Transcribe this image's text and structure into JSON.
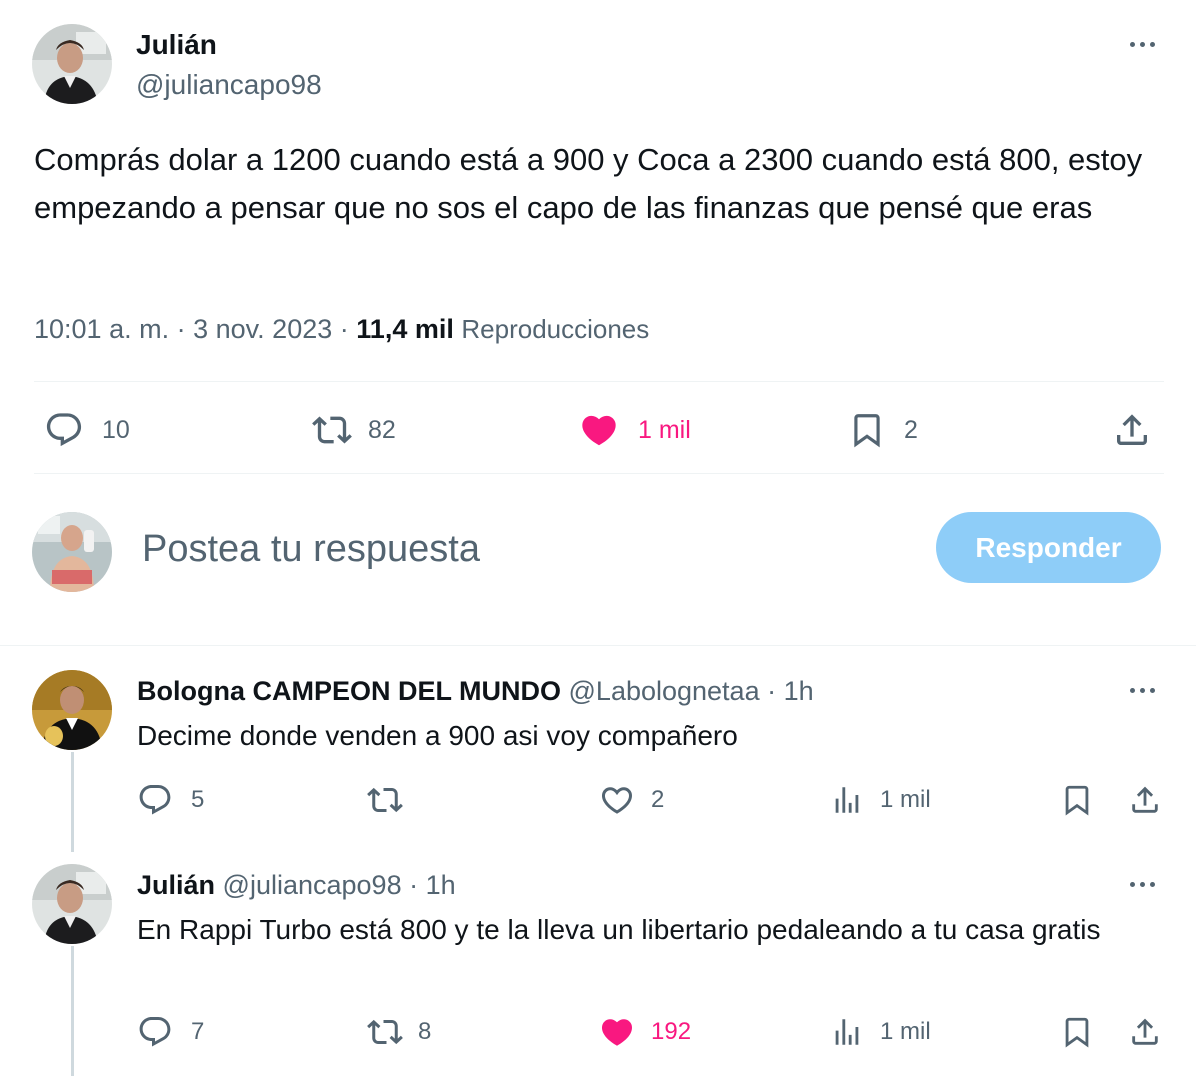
{
  "main_tweet": {
    "author_name": "Julián",
    "author_handle": "@juliancapo98",
    "text": "Comprás dolar a 1200 cuando está a 900 y Coca a 2300 cuando está 800, estoy empezando a pensar que no sos el capo de las finanzas que pensé que eras",
    "time": "10:01 a. m.",
    "sep1": "·",
    "date": "3 nov. 2023",
    "sep2": "·",
    "views_count": "11,4 mil",
    "views_label": "Reproducciones",
    "replies": "10",
    "retweets": "82",
    "likes": "1 mil",
    "bookmarks": "2",
    "liked": true
  },
  "reply_box": {
    "placeholder": "Postea tu respuesta",
    "button_label": "Responder"
  },
  "replies": [
    {
      "author_name": "Bologna CAMPEON DEL MUNDO",
      "author_handle": "@Labolognetaa",
      "sep": "·",
      "time": "1h",
      "text": "Decime donde venden a 900 asi voy compañero",
      "replies": "5",
      "retweets": "",
      "likes": "2",
      "views": "1 mil",
      "liked": false
    },
    {
      "author_name": "Julián",
      "author_handle": "@juliancapo98",
      "sep": "·",
      "time": "1h",
      "text": "En Rappi Turbo está 800 y te la lleva un libertario pedaleando a tu casa gratis",
      "replies": "7",
      "retweets": "8",
      "likes": "192",
      "views": "1 mil",
      "liked": true
    }
  ],
  "colors": {
    "text": "#0f1419",
    "secondary": "#536471",
    "like_active": "#f91880",
    "button_disabled": "#8ecdf8",
    "divider": "#eff3f4",
    "thread_line": "#cfd9de"
  },
  "icons": [
    "reply-icon",
    "retweet-icon",
    "like-icon",
    "bookmark-icon",
    "share-icon",
    "views-icon",
    "more-icon"
  ]
}
